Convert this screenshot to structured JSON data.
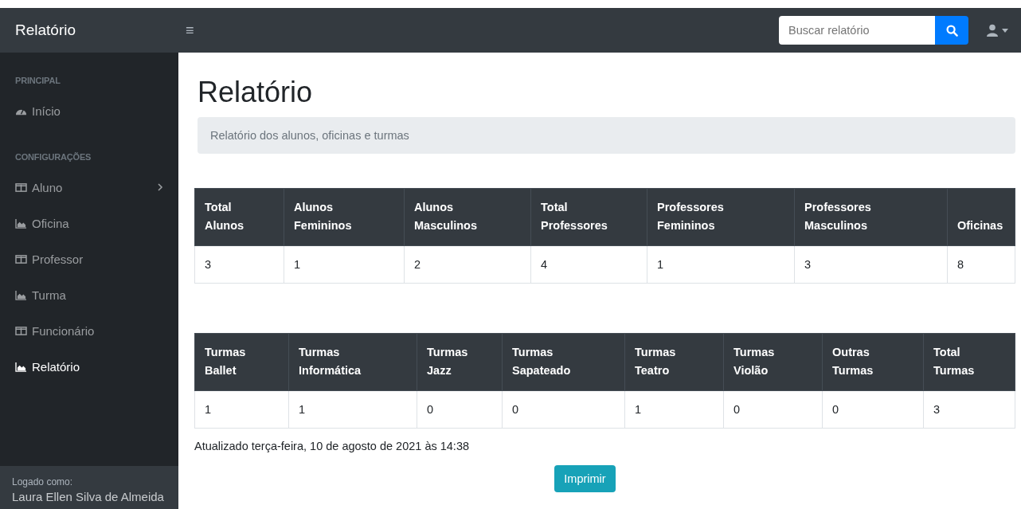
{
  "navbar": {
    "brand": "Relatório",
    "menu_icon": "≡",
    "search": {
      "placeholder": "Buscar relatório"
    }
  },
  "sidebar": {
    "sections": [
      {
        "heading": "PRINCIPAL",
        "items": [
          {
            "label": "Início",
            "kind": "gauge",
            "selected": false,
            "expandable": false
          }
        ]
      },
      {
        "heading": "CONFIGURAÇÕES",
        "items": [
          {
            "label": "Aluno",
            "kind": "table",
            "selected": false,
            "expandable": true
          },
          {
            "label": "Oficina",
            "kind": "chart",
            "selected": false,
            "expandable": false
          },
          {
            "label": "Professor",
            "kind": "table",
            "selected": false,
            "expandable": false
          },
          {
            "label": "Turma",
            "kind": "chart",
            "selected": false,
            "expandable": false
          },
          {
            "label": "Funcionário",
            "kind": "table",
            "selected": false,
            "expandable": false
          },
          {
            "label": "Relatório",
            "kind": "chart",
            "selected": true,
            "expandable": false
          }
        ]
      }
    ],
    "footer": {
      "caption": "Logado como:",
      "user": "Laura Ellen Silva de Almeida"
    }
  },
  "page": {
    "title": "Relatório",
    "breadcrumb": "Relatório dos alunos, oficinas e turmas",
    "tables": [
      {
        "columns": [
          "Total Alunos",
          "Alunos Femininos",
          "Alunos Masculinos",
          "Total Professores",
          "Professores Femininos",
          "Professores Masculinos",
          "Oficinas"
        ],
        "rows": [
          [
            "3",
            "1",
            "2",
            "4",
            "1",
            "3",
            "8"
          ]
        ]
      },
      {
        "columns": [
          "Turmas Ballet",
          "Turmas Informática",
          "Turmas Jazz",
          "Turmas Sapateado",
          "Turmas Teatro",
          "Turmas Violão",
          "Outras Turmas",
          "Total Turmas"
        ],
        "rows": [
          [
            "1",
            "1",
            "0",
            "0",
            "1",
            "0",
            "0",
            "3"
          ]
        ]
      }
    ],
    "updated": "Atualizado terça-feira, 10 de agosto de 2021 às 14:38",
    "print_button": "Imprimir"
  }
}
